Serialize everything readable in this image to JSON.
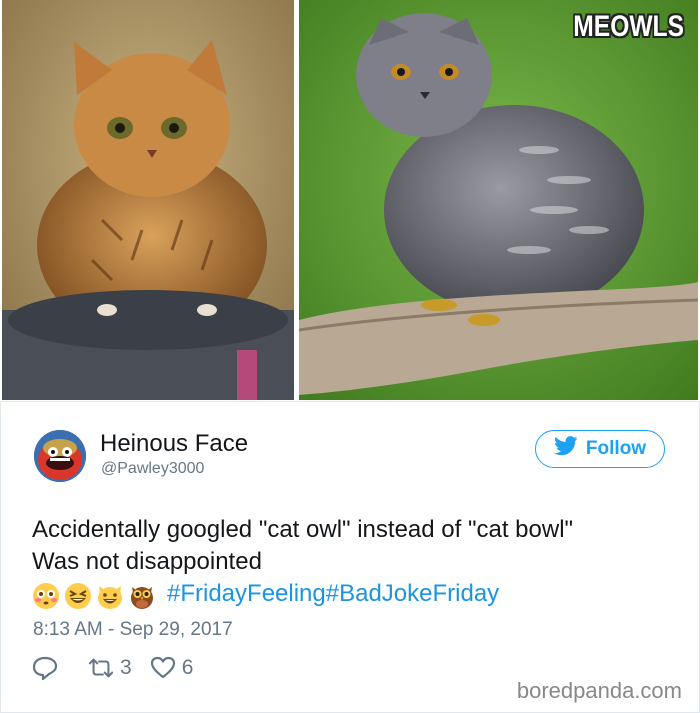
{
  "images": {
    "watermark": "MEOWLS"
  },
  "tweet": {
    "author_name": "Heinous Face",
    "author_handle": "@Pawley3000",
    "follow_label": "Follow",
    "text_line1": "Accidentally googled \"cat owl\" instead of \"cat bowl\"",
    "text_line2": "Was not disappointed",
    "emojis": [
      "flushed-face",
      "grinning-squinting-face",
      "grinning-cat",
      "owl"
    ],
    "hashtags": "#FridayFeeling#BadJokeFriday",
    "timestamp": "8:13 AM - Sep 29, 2017",
    "reply_count": "",
    "retweet_count": "3",
    "like_count": "6"
  },
  "footer": {
    "site": "boredpanda.com"
  },
  "colors": {
    "twitter_blue": "#1da1f2",
    "hashtag_blue": "#1b95e0",
    "muted_gray": "#657786"
  }
}
